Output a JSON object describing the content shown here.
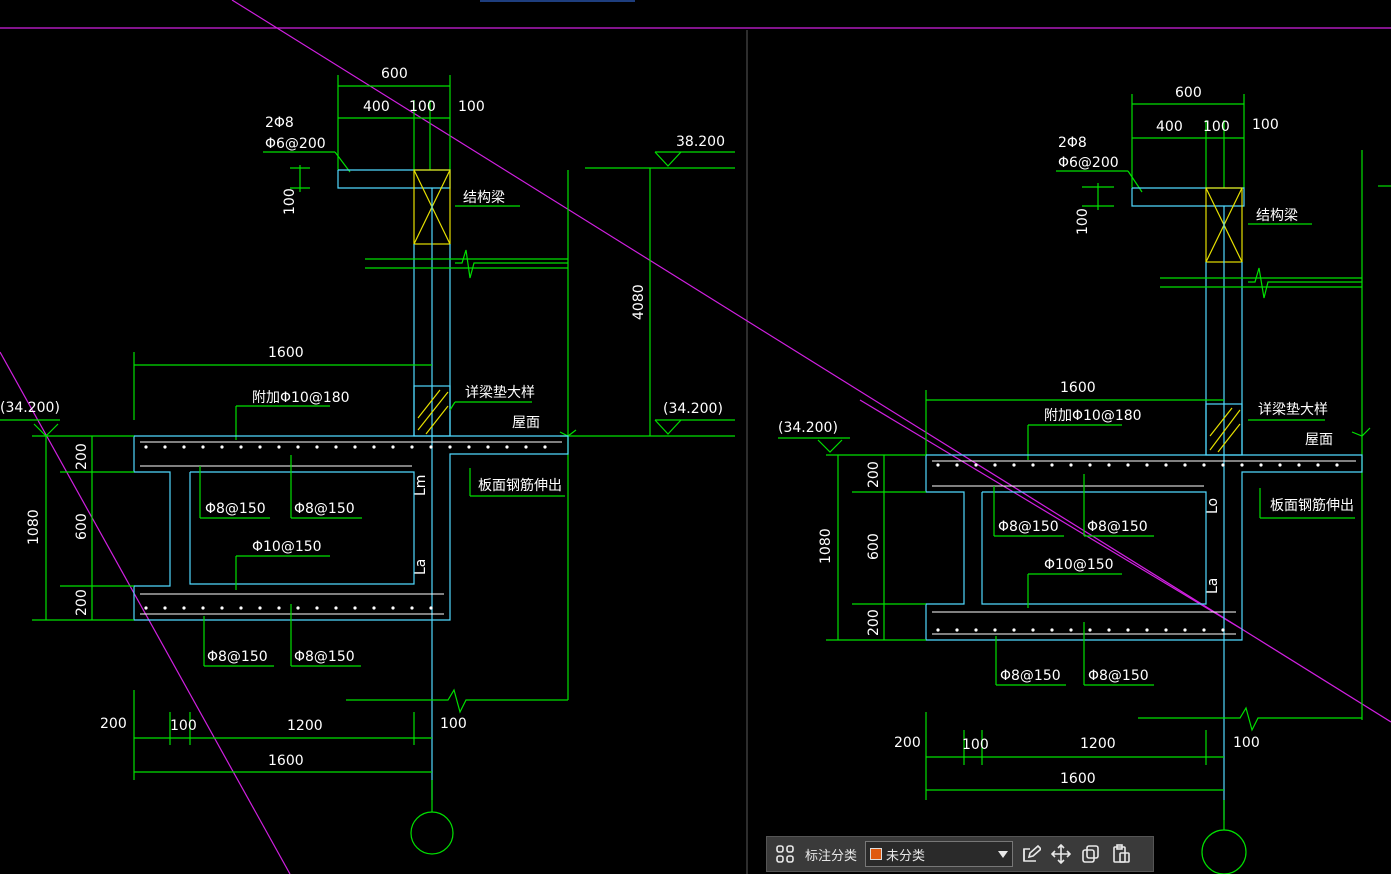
{
  "drawing": {
    "left_detail": {
      "dims": {
        "top_total": "600",
        "top_a": "400",
        "top_b": "100",
        "top_c": "100",
        "side_100": "100",
        "height_4080": "4080",
        "width_1600": "1600",
        "h_200a": "200",
        "h_600": "600",
        "h_200b": "200",
        "h_1080": "1080",
        "bot_200": "200",
        "bot_100a": "100",
        "bot_1200": "1200",
        "bot_100b": "100",
        "bot_1600": "1600"
      },
      "levels": {
        "top": "38.200",
        "left": "(34.200)",
        "right": "(34.200)"
      },
      "labels": {
        "rebar_2phi8": "2Φ8",
        "rebar_phi6": "Φ6@200",
        "structural_beam": "结构梁",
        "added_rebar": "附加Φ10@180",
        "beam_pad_detail": "详梁垫大样",
        "roof_surface": "屋面",
        "slab_rebar_extend": "板面钢筋伸出",
        "phi8_a": "Φ8@150",
        "phi8_b": "Φ8@150",
        "phi10": "Φ10@150",
        "phi8_c": "Φ8@150",
        "phi8_d": "Φ8@150",
        "lm": "Lm",
        "la": "La"
      }
    },
    "right_detail": {
      "dims": {
        "top_total": "600",
        "top_a": "400",
        "top_b": "100",
        "top_c": "100",
        "side_100": "100",
        "width_1600": "1600",
        "h_200a": "200",
        "h_600": "600",
        "h_200b": "200",
        "h_1080": "1080",
        "bot_200": "200",
        "bot_100a": "100",
        "bot_1200": "1200",
        "bot_100b": "100",
        "bot_1600": "1600"
      },
      "levels": {
        "left": "(34.200)"
      },
      "labels": {
        "rebar_2phi8": "2Φ8",
        "rebar_phi6": "Φ6@200",
        "structural_beam": "结构梁",
        "added_rebar": "附加Φ10@180",
        "beam_pad_detail": "详梁垫大样",
        "roof_surface": "屋面",
        "slab_rebar_extend": "板面钢筋伸出",
        "phi8_a": "Φ8@150",
        "phi8_b": "Φ8@150",
        "phi10": "Φ10@150",
        "phi8_c": "Φ8@150",
        "phi8_d": "Φ8@150",
        "lm": "Lo",
        "la": "La"
      }
    },
    "colors": {
      "background": "#000000",
      "dimension": "#00e000",
      "outline": "#4fd9ff",
      "axis": "#d020e0",
      "beam": "#e6e000"
    }
  },
  "toolbar": {
    "label": "标注分类",
    "select_value": "未分类",
    "swatch_color": "#e05a10",
    "icons": [
      "grid-icon",
      "edit-icon",
      "move-icon",
      "copy-icon",
      "paste-icon"
    ]
  }
}
